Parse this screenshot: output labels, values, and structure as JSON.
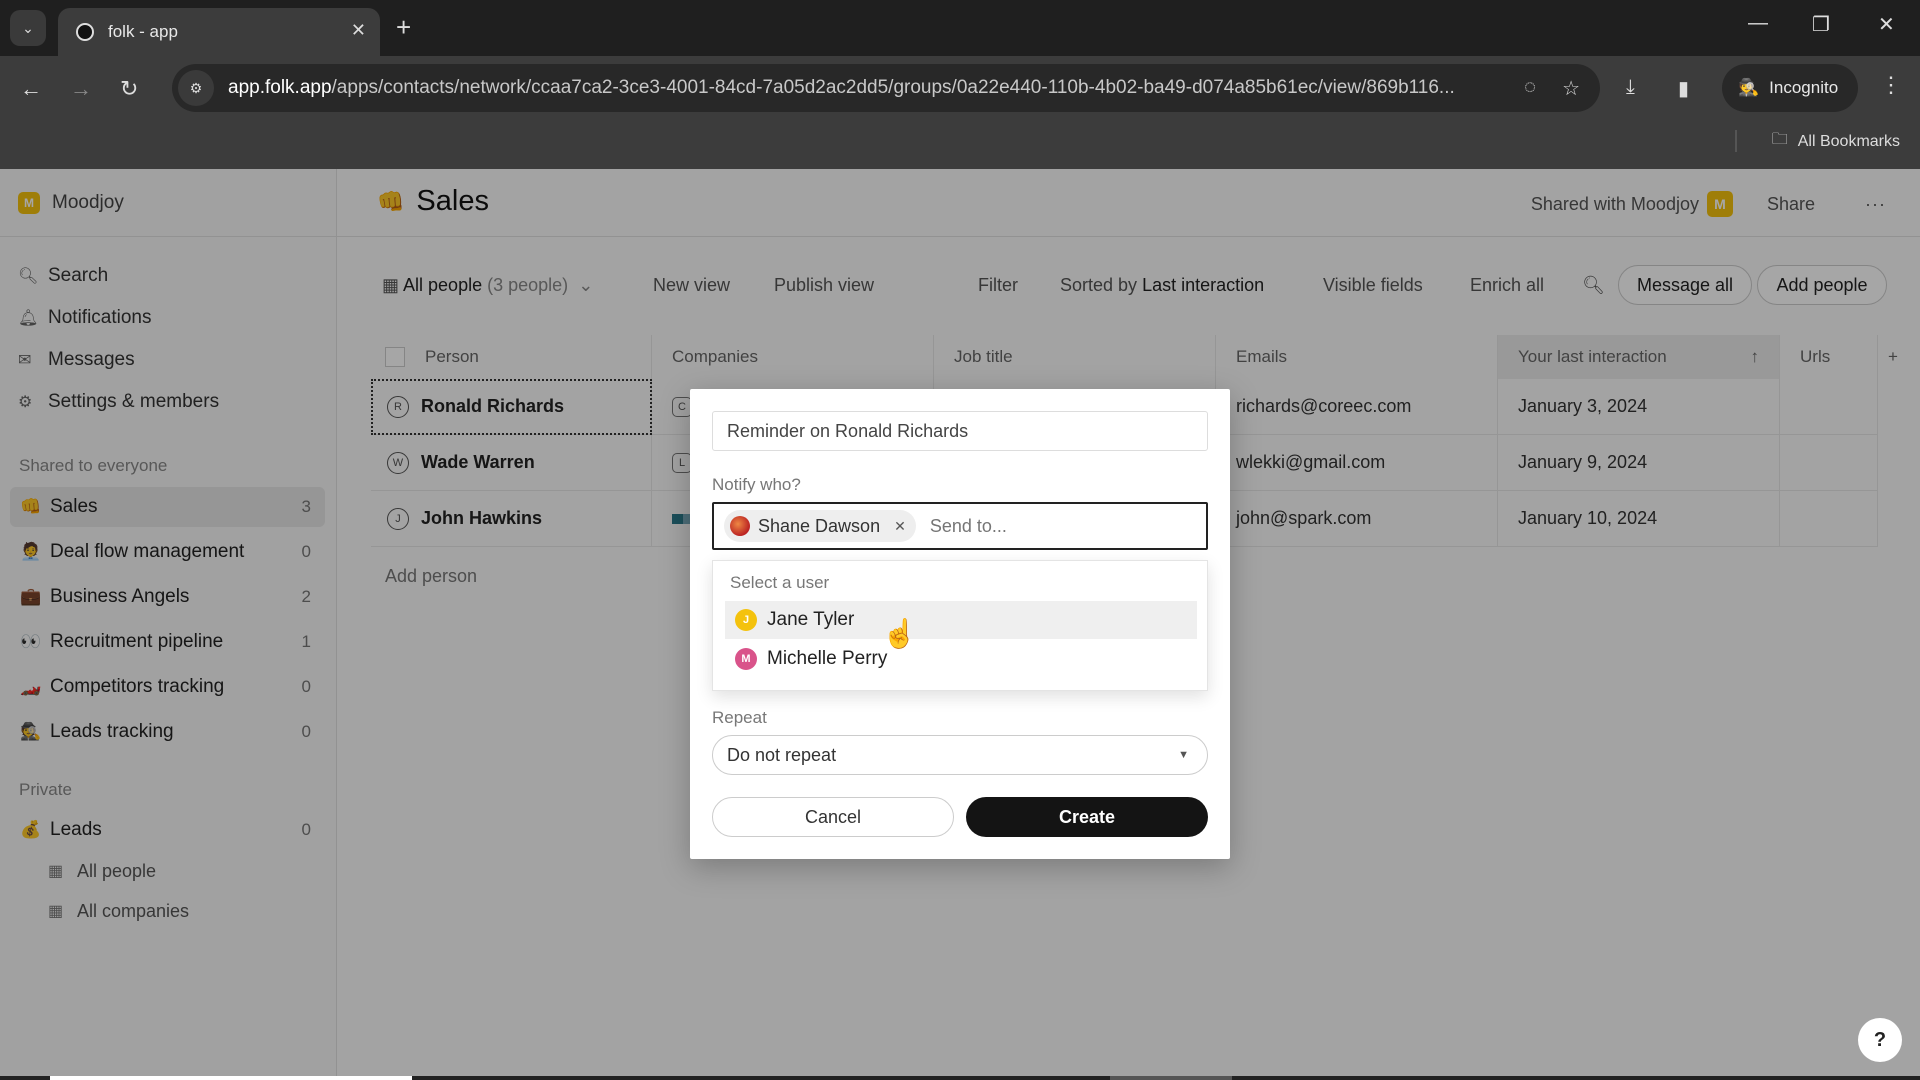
{
  "browser": {
    "tab_title": "folk - app",
    "url_host": "app.folk.app",
    "url_path": "/apps/contacts/network/ccaa7ca2-3ce3-4001-84cd-7a05d2ac2dd5/groups/0a22e440-110b-4b02-ba49-d074a85b61ec/view/869b116...",
    "incognito_label": "Incognito",
    "bookmarks_label": "All Bookmarks"
  },
  "sidebar": {
    "workspace_name": "Moodjoy",
    "workspace_initial": "M",
    "nav": [
      {
        "label": "Search",
        "icon": "search-icon"
      },
      {
        "label": "Notifications",
        "icon": "bell-icon"
      },
      {
        "label": "Messages",
        "icon": "mail-icon"
      },
      {
        "label": "Settings & members",
        "icon": "gear-icon"
      }
    ],
    "shared_section_label": "Shared to everyone",
    "shared_groups": [
      {
        "label": "Sales",
        "count": "3",
        "emoji": "👊",
        "active": true
      },
      {
        "label": "Deal flow management",
        "count": "0",
        "emoji": "🧑‍💼"
      },
      {
        "label": "Business Angels",
        "count": "2",
        "emoji": "💼"
      },
      {
        "label": "Recruitment pipeline",
        "count": "1",
        "emoji": "👀"
      },
      {
        "label": "Competitors tracking",
        "count": "0",
        "emoji": "🏎️"
      },
      {
        "label": "Leads tracking",
        "count": "0",
        "emoji": "🕵️"
      }
    ],
    "private_section_label": "Private",
    "private_groups": [
      {
        "label": "Leads",
        "count": "0",
        "emoji": "💰"
      }
    ],
    "private_views": [
      {
        "label": "All people"
      },
      {
        "label": "All companies"
      }
    ]
  },
  "header": {
    "title": "Sales",
    "title_emoji": "👊",
    "shared_with": "Shared with Moodjoy",
    "shared_badge": "M",
    "share_label": "Share",
    "more_label": "···"
  },
  "toolbar": {
    "view_label": "All people",
    "view_count": "(3 people)",
    "new_view": "New view",
    "publish_view": "Publish view",
    "filter": "Filter",
    "sorted_prefix": "Sorted by",
    "sorted_field": "Last interaction",
    "visible_fields": "Visible fields",
    "enrich_all": "Enrich all",
    "message_all": "Message all",
    "add_people": "Add people"
  },
  "table": {
    "columns": [
      "Person",
      "Companies",
      "Job title",
      "Emails",
      "Your last interaction",
      "Urls"
    ],
    "rows": [
      {
        "initial": "R",
        "person": "Ronald Richards",
        "company_initial": "C",
        "job_title": "",
        "email": "richards@coreec.com",
        "last_interaction": "January 3, 2024",
        "urls": ""
      },
      {
        "initial": "W",
        "person": "Wade Warren",
        "company_initial": "L",
        "job_title": "",
        "email": "wlekki@gmail.com",
        "last_interaction": "January 9, 2024",
        "urls": ""
      },
      {
        "initial": "J",
        "person": "John Hawkins",
        "company_initial": "",
        "job_title": "",
        "email": "john@spark.com",
        "last_interaction": "January 10, 2024",
        "urls": ""
      }
    ],
    "add_person": "Add person"
  },
  "modal": {
    "title_value": "Reminder on Ronald Richards",
    "notify_label": "Notify who?",
    "selected_user": "Shane Dawson",
    "send_to_placeholder": "Send to...",
    "dropdown_header": "Select a user",
    "users": [
      {
        "name": "Jane Tyler",
        "initial": "J",
        "color": "#f4c20d",
        "hovered": true
      },
      {
        "name": "Michelle Perry",
        "initial": "M",
        "color": "#d9538a",
        "hovered": false
      }
    ],
    "repeat_label": "Repeat",
    "repeat_value": "Do not repeat",
    "cancel_label": "Cancel",
    "create_label": "Create"
  },
  "help_label": "?"
}
